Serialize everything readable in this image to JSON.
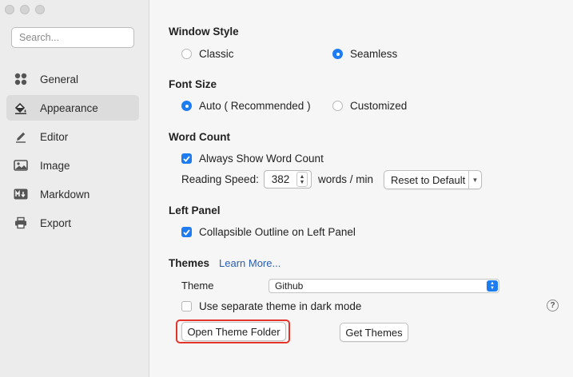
{
  "sidebar": {
    "search_placeholder": "Search...",
    "items": [
      {
        "label": "General",
        "icon": "grid-icon",
        "active": false
      },
      {
        "label": "Appearance",
        "icon": "paint-bucket-icon",
        "active": true
      },
      {
        "label": "Editor",
        "icon": "pencil-icon",
        "active": false
      },
      {
        "label": "Image",
        "icon": "image-icon",
        "active": false
      },
      {
        "label": "Markdown",
        "icon": "markdown-icon",
        "active": false
      },
      {
        "label": "Export",
        "icon": "printer-icon",
        "active": false
      }
    ]
  },
  "window_style": {
    "title": "Window Style",
    "options": [
      {
        "label": "Classic",
        "selected": false
      },
      {
        "label": "Seamless",
        "selected": true
      }
    ]
  },
  "font_size": {
    "title": "Font Size",
    "options": [
      {
        "label": "Auto ( Recommended )",
        "selected": true
      },
      {
        "label": "Customized",
        "selected": false
      }
    ]
  },
  "word_count": {
    "title": "Word Count",
    "always_show_label": "Always Show Word Count",
    "always_show_checked": true,
    "reading_speed_label": "Reading Speed:",
    "reading_speed_value": "382",
    "unit_label": "words / min",
    "reset_button": "Reset to Default"
  },
  "left_panel": {
    "title": "Left Panel",
    "collapsible_label": "Collapsible Outline on Left Panel",
    "collapsible_checked": true
  },
  "themes": {
    "title": "Themes",
    "learn_more": "Learn More...",
    "theme_label": "Theme",
    "theme_value": "Github",
    "separate_dark_label": "Use separate theme in dark mode",
    "separate_dark_checked": false,
    "open_folder_button": "Open Theme Folder",
    "get_themes_button": "Get Themes",
    "help_symbol": "?"
  },
  "colors": {
    "accent": "#1e7cf2",
    "highlight": "#e5342a",
    "link": "#2a5db0"
  }
}
